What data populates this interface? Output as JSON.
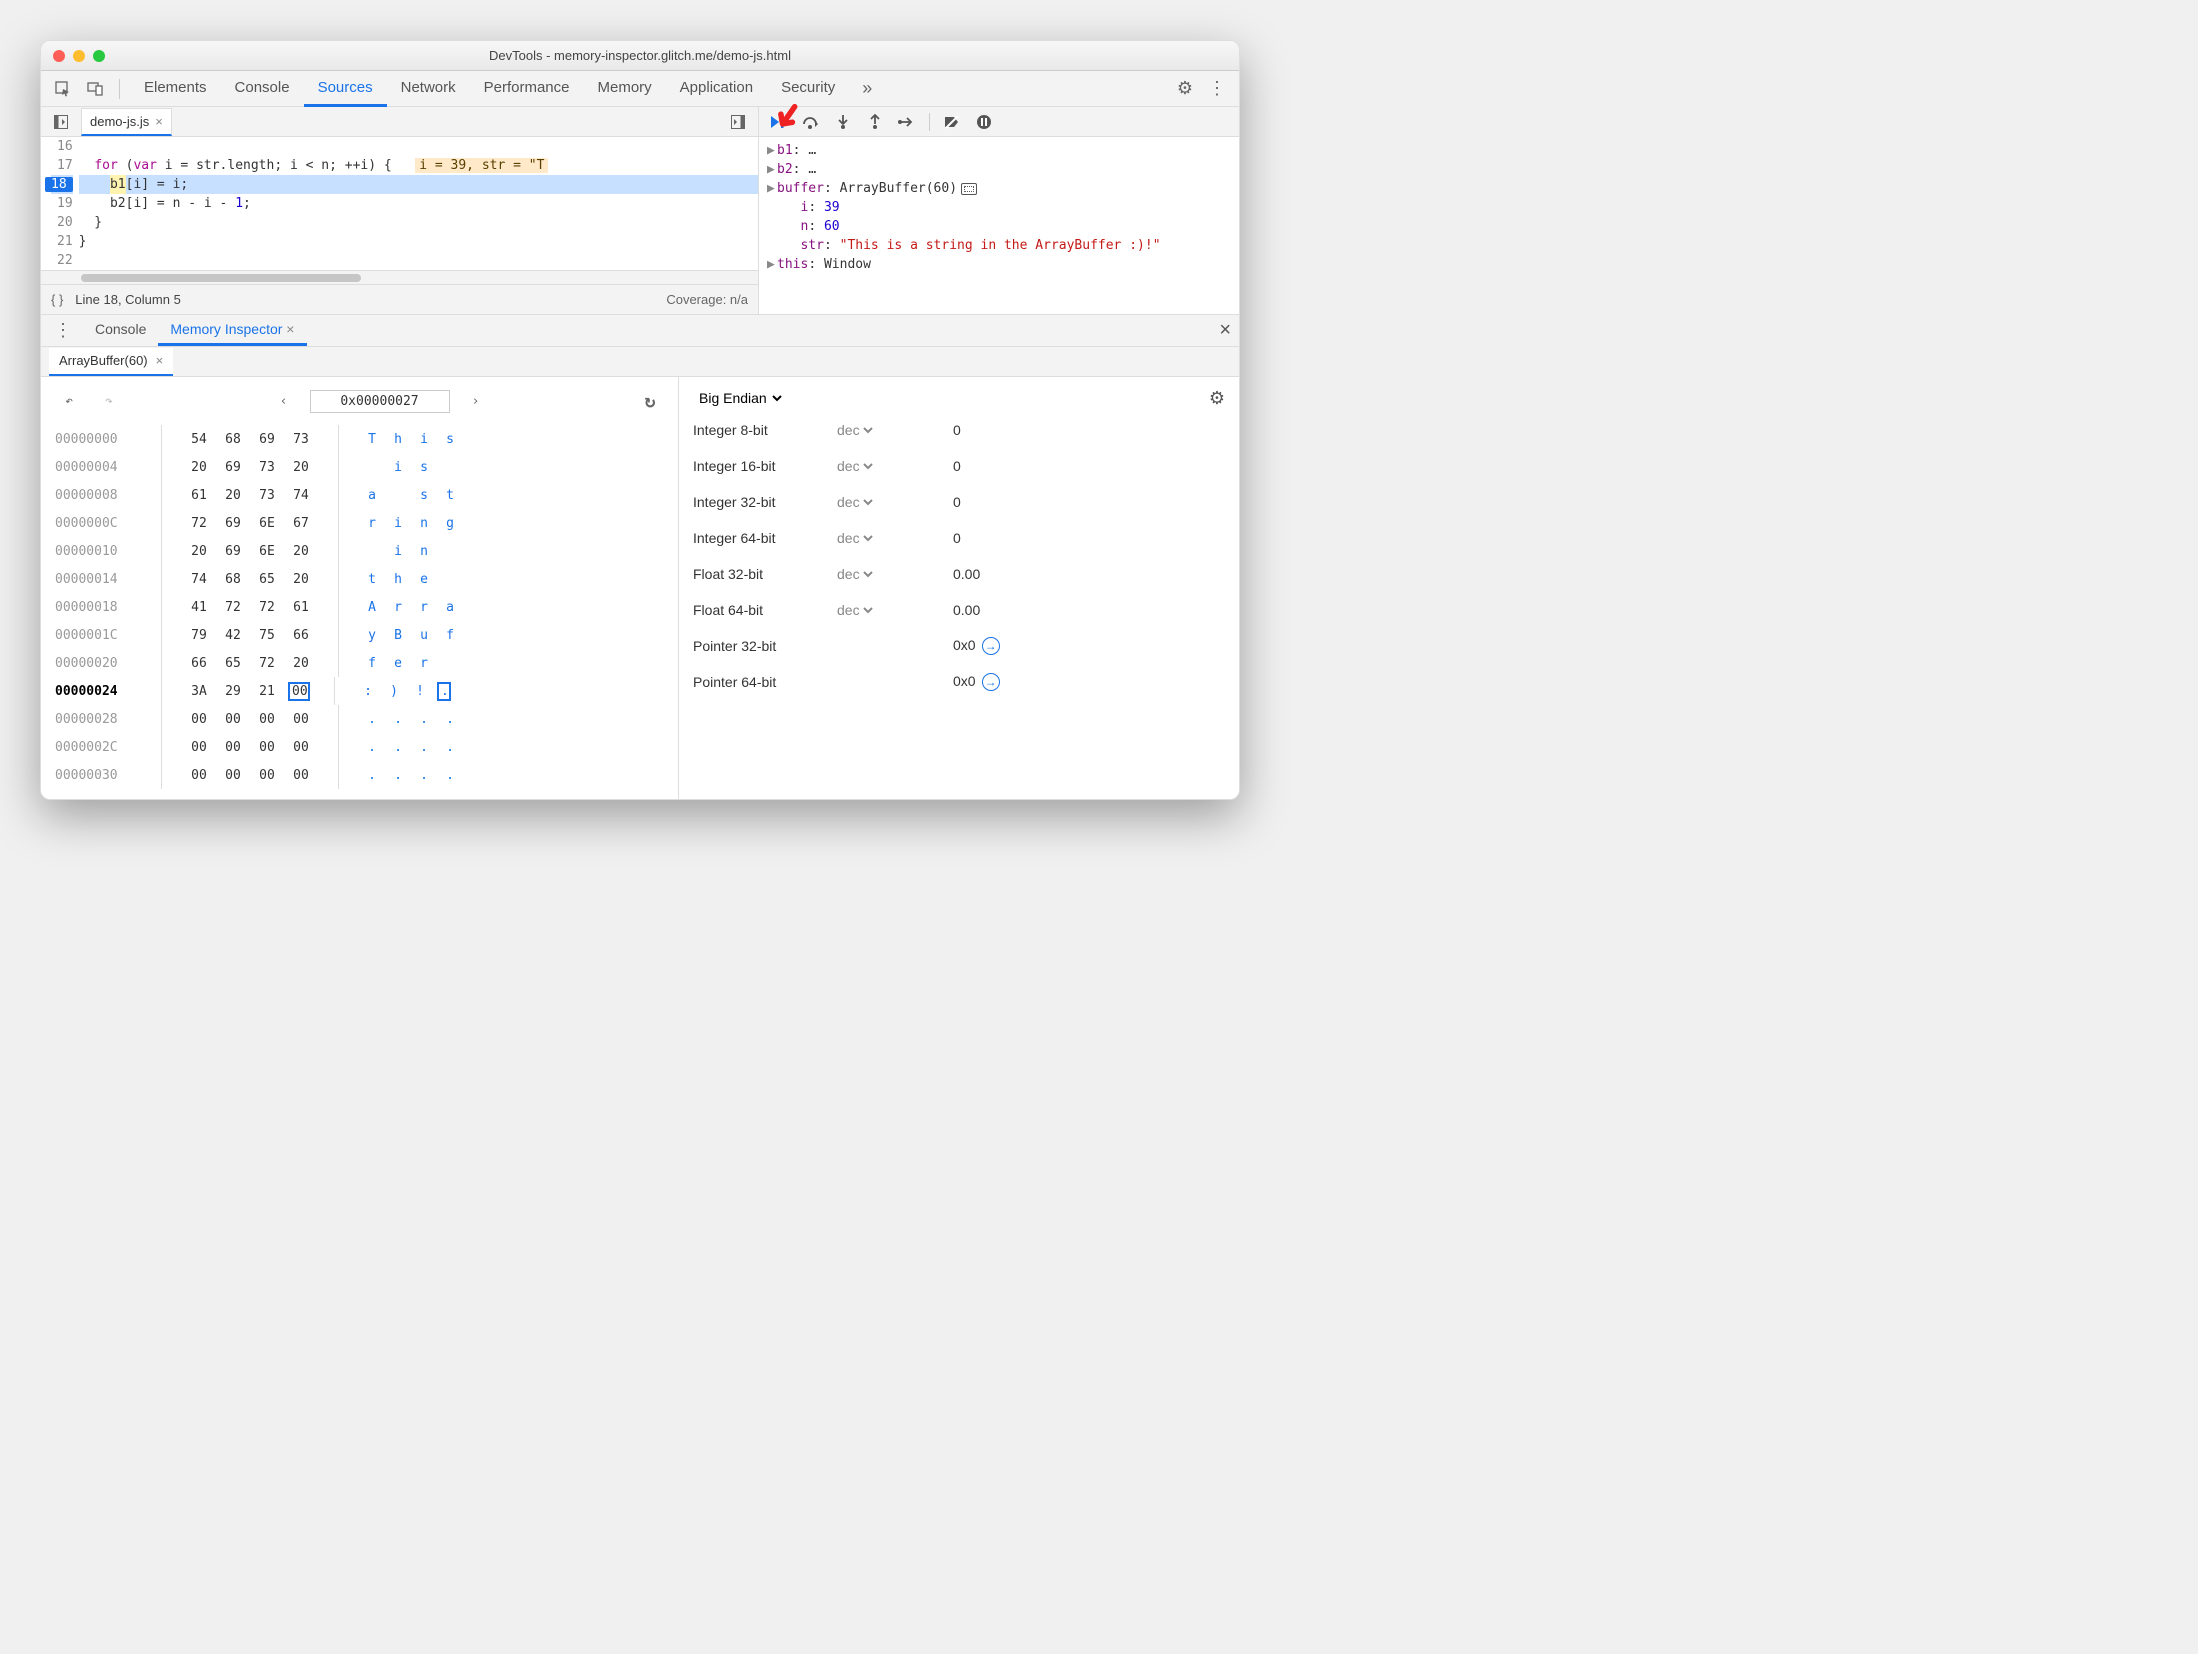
{
  "window": {
    "title": "DevTools - memory-inspector.glitch.me/demo-js.html"
  },
  "mainTabs": {
    "items": [
      "Elements",
      "Console",
      "Sources",
      "Network",
      "Performance",
      "Memory",
      "Application",
      "Security"
    ],
    "active": "Sources"
  },
  "sources": {
    "tab": "demo-js.js",
    "lines": [
      {
        "n": 16,
        "text": ""
      },
      {
        "n": 17,
        "text": "  for (var i = str.length; i < n; ++i) {",
        "inline": "i = 39, str = \"T"
      },
      {
        "n": 18,
        "text": "    b1[i] = i;",
        "bp": true,
        "hl": true
      },
      {
        "n": 19,
        "text": "    b2[i] = n - i - 1;"
      },
      {
        "n": 20,
        "text": "  }"
      },
      {
        "n": 21,
        "text": "}"
      },
      {
        "n": 22,
        "text": ""
      }
    ],
    "status": {
      "pos": "Line 18, Column 5",
      "coverage": "Coverage: n/a"
    }
  },
  "scope": {
    "rows": [
      {
        "tri": true,
        "key": "b1",
        "val": "…"
      },
      {
        "tri": true,
        "key": "b2",
        "val": "…"
      },
      {
        "tri": true,
        "key": "buffer",
        "val": "ArrayBuffer(60)",
        "mem": true
      },
      {
        "key": "i",
        "val": "39",
        "num": true,
        "indent": true
      },
      {
        "key": "n",
        "val": "60",
        "num": true,
        "indent": true
      },
      {
        "key": "str",
        "val": "\"This is a string in the ArrayBuffer :)!\"",
        "str": true,
        "indent": true
      },
      {
        "tri": true,
        "key": "this",
        "val": "Window"
      }
    ]
  },
  "drawer": {
    "tabs": [
      "Console",
      "Memory Inspector"
    ],
    "active": "Memory Inspector",
    "bufferTab": "ArrayBuffer(60)"
  },
  "hex": {
    "address": "0x00000027",
    "rows": [
      {
        "addr": "00000000",
        "b": [
          "54",
          "68",
          "69",
          "73"
        ],
        "a": [
          "T",
          "h",
          "i",
          "s"
        ]
      },
      {
        "addr": "00000004",
        "b": [
          "20",
          "69",
          "73",
          "20"
        ],
        "a": [
          " ",
          "i",
          "s",
          " "
        ]
      },
      {
        "addr": "00000008",
        "b": [
          "61",
          "20",
          "73",
          "74"
        ],
        "a": [
          "a",
          " ",
          "s",
          "t"
        ]
      },
      {
        "addr": "0000000C",
        "b": [
          "72",
          "69",
          "6E",
          "67"
        ],
        "a": [
          "r",
          "i",
          "n",
          "g"
        ]
      },
      {
        "addr": "00000010",
        "b": [
          "20",
          "69",
          "6E",
          "20"
        ],
        "a": [
          " ",
          "i",
          "n",
          " "
        ]
      },
      {
        "addr": "00000014",
        "b": [
          "74",
          "68",
          "65",
          "20"
        ],
        "a": [
          "t",
          "h",
          "e",
          " "
        ]
      },
      {
        "addr": "00000018",
        "b": [
          "41",
          "72",
          "72",
          "61"
        ],
        "a": [
          "A",
          "r",
          "r",
          "a"
        ]
      },
      {
        "addr": "0000001C",
        "b": [
          "79",
          "42",
          "75",
          "66"
        ],
        "a": [
          "y",
          "B",
          "u",
          "f"
        ]
      },
      {
        "addr": "00000020",
        "b": [
          "66",
          "65",
          "72",
          "20"
        ],
        "a": [
          "f",
          "e",
          "r",
          " "
        ]
      },
      {
        "addr": "00000024",
        "b": [
          "3A",
          "29",
          "21",
          "00"
        ],
        "a": [
          ":",
          ")",
          "!",
          "."
        ],
        "bold": true,
        "sel": 3
      },
      {
        "addr": "00000028",
        "b": [
          "00",
          "00",
          "00",
          "00"
        ],
        "a": [
          ".",
          ".",
          ".",
          "."
        ]
      },
      {
        "addr": "0000002C",
        "b": [
          "00",
          "00",
          "00",
          "00"
        ],
        "a": [
          ".",
          ".",
          ".",
          "."
        ]
      },
      {
        "addr": "00000030",
        "b": [
          "00",
          "00",
          "00",
          "00"
        ],
        "a": [
          ".",
          ".",
          ".",
          "."
        ]
      }
    ]
  },
  "values": {
    "endian": "Big Endian",
    "rows": [
      {
        "label": "Integer 8-bit",
        "enc": "dec",
        "val": "0"
      },
      {
        "label": "Integer 16-bit",
        "enc": "dec",
        "val": "0"
      },
      {
        "label": "Integer 32-bit",
        "enc": "dec",
        "val": "0"
      },
      {
        "label": "Integer 64-bit",
        "enc": "dec",
        "val": "0"
      },
      {
        "label": "Float 32-bit",
        "enc": "dec",
        "val": "0.00"
      },
      {
        "label": "Float 64-bit",
        "enc": "dec",
        "val": "0.00"
      },
      {
        "label": "Pointer 32-bit",
        "enc": "",
        "val": "0x0",
        "ptr": true
      },
      {
        "label": "Pointer 64-bit",
        "enc": "",
        "val": "0x0",
        "ptr": true
      }
    ]
  }
}
